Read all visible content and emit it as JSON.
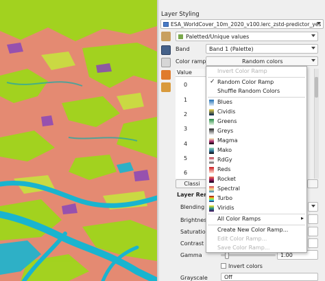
{
  "panel": {
    "title": "Layer Styling",
    "layer_name": "ESA_WorldCover_10m_2020_v100.lerc_zstd-predictor_yes",
    "renderer": "Paletted/Unique values",
    "band_label": "Band",
    "band_value": "Band 1 (Palette)",
    "color_ramp_label": "Color ramp",
    "color_ramp_value": "Random colors",
    "value_header": "Value",
    "values": [
      "0",
      "1",
      "2",
      "3",
      "4",
      "5",
      "6"
    ],
    "classify_button": "Classi",
    "layer_rendering": "Layer Rend",
    "blending": "Blending m",
    "brightness": "Brightness",
    "saturation": "Saturation",
    "contrast": "Contrast",
    "gamma": "Gamma",
    "gamma_value": "1.00",
    "invert_colors": "Invert colors",
    "grayscale": "Grayscale",
    "grayscale_value": "Off"
  },
  "menu": {
    "invert": "Invert Color Ramp",
    "random": "Random Color Ramp",
    "shuffle": "Shuffle Random Colors",
    "ramps": [
      {
        "name": "Blues",
        "c1": "#deebf7",
        "c2": "#2171b5"
      },
      {
        "name": "Cividis",
        "c1": "#00204c",
        "c2": "#e9d24a"
      },
      {
        "name": "Greens",
        "c1": "#e5f5e0",
        "c2": "#238b45"
      },
      {
        "name": "Greys",
        "c1": "#f0f0f0",
        "c2": "#252525"
      },
      {
        "name": "Magma",
        "c1": "#000004",
        "c2": "#fcfdbf"
      },
      {
        "name": "Mako",
        "c1": "#0b0405",
        "c2": "#8ad9b1"
      },
      {
        "name": "RdGy",
        "c1": "#b2182b",
        "c2": "#4d4d4d"
      },
      {
        "name": "Reds",
        "c1": "#fee0d2",
        "c2": "#cb181d"
      },
      {
        "name": "Rocket",
        "c1": "#03051a",
        "c2": "#f37651"
      },
      {
        "name": "Spectral",
        "c1": "#d53e4f",
        "c2": "#3288bd"
      },
      {
        "name": "Turbo",
        "c1": "#30123b",
        "c2": "#a2fc3c"
      },
      {
        "name": "Viridis",
        "c1": "#440154",
        "c2": "#fde725"
      }
    ],
    "all_ramps": "All Color Ramps",
    "create": "Create New Color Ramp...",
    "edit": "Edit Color Ramp...",
    "save": "Save Color Ramp..."
  },
  "colors": {
    "map_salmon": "#e48a72",
    "map_green": "#9fd61b",
    "map_cyan": "#19b4cf",
    "map_purple": "#8a47b8",
    "map_teal": "#2ea6a0",
    "map_lime": "#c6e63b"
  }
}
